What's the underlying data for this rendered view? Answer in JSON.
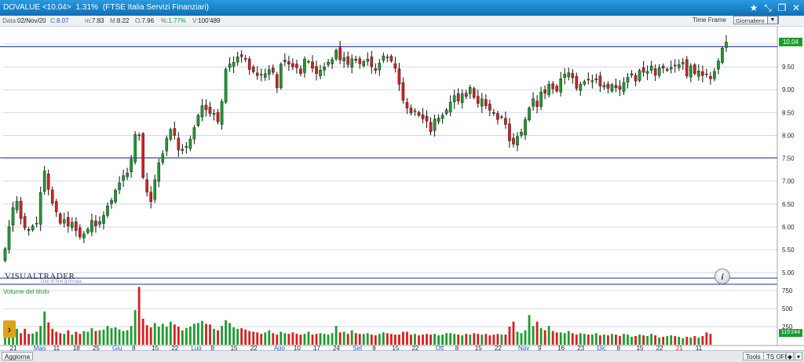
{
  "header": {
    "symbol": "DOVALUE <10.04>",
    "change": "1.31%",
    "market": "(FTSE Italia Servizi Finanziari)"
  },
  "quote": {
    "data_label": "Data:",
    "data_value": "02/Nov/20",
    "close_label": "C:",
    "close_value": "8.07",
    "min_label": "m:",
    "min_value": "7.83",
    "max_label": "M:",
    "max_value": "8.22",
    "open_label": "O:",
    "open_value": "7.96",
    "pct_label": "%:",
    "pct_value": "1.77%",
    "vol_label": "V:",
    "vol_value": "100'489"
  },
  "timeframe": {
    "label": "Time Frame",
    "selected": "Giornaliero"
  },
  "branding": {
    "logo": "VISUALTRADER",
    "subtitle": "Dati di fine giornata"
  },
  "volume_label": "Volume del titolo",
  "price_tag": "10.04",
  "volume_tag": "115'244",
  "bottom": {
    "refresh": "Aggiorna",
    "tools": "Tools",
    "ts": "TS OFF"
  },
  "colors": {
    "up": "#1e9b2e",
    "down": "#d42020",
    "hline": "#1f2f9a",
    "grid": "#d4d8e6",
    "title_bg": "#1a82cc"
  },
  "icons": [
    "star-icon",
    "resize-icon",
    "restore-icon",
    "close-icon",
    "info-icon",
    "chevron-right-icon"
  ],
  "chart_data": {
    "type": "candlestick",
    "y_ticks": [
      "10.00",
      "9.50",
      "9.00",
      "8.50",
      "8.00",
      "7.50",
      "7.00",
      "6.50",
      "6.00",
      "5.50",
      "5.00"
    ],
    "ylim": [
      4.85,
      10.25
    ],
    "volume_ticks": [
      "750",
      "500",
      "250"
    ],
    "volume_lim": [
      0,
      900
    ],
    "horizontal_levels": [
      9.94,
      7.51,
      4.88
    ],
    "x_labels": [
      {
        "text": "21",
        "i": 2,
        "month": false
      },
      {
        "text": "Mag",
        "i": 8,
        "month": true
      },
      {
        "text": "11",
        "i": 13,
        "month": false
      },
      {
        "text": "18",
        "i": 18,
        "month": false
      },
      {
        "text": "25",
        "i": 23,
        "month": false
      },
      {
        "text": "Giu",
        "i": 28,
        "month": true
      },
      {
        "text": "8",
        "i": 33,
        "month": false
      },
      {
        "text": "15",
        "i": 38,
        "month": false
      },
      {
        "text": "22",
        "i": 43,
        "month": false
      },
      {
        "text": "Lug",
        "i": 48,
        "month": true
      },
      {
        "text": "8",
        "i": 53,
        "month": false
      },
      {
        "text": "15",
        "i": 58,
        "month": false
      },
      {
        "text": "22",
        "i": 63,
        "month": false
      },
      {
        "text": "Ago",
        "i": 69,
        "month": true
      },
      {
        "text": "10",
        "i": 74,
        "month": false
      },
      {
        "text": "17",
        "i": 79,
        "month": false
      },
      {
        "text": "24",
        "i": 84,
        "month": false
      },
      {
        "text": "Set",
        "i": 89,
        "month": true
      },
      {
        "text": "8",
        "i": 94,
        "month": false
      },
      {
        "text": "15",
        "i": 99,
        "month": false
      },
      {
        "text": "22",
        "i": 104,
        "month": false
      },
      {
        "text": "Ott",
        "i": 110,
        "month": true
      },
      {
        "text": "8",
        "i": 115,
        "month": false
      },
      {
        "text": "15",
        "i": 120,
        "month": false
      },
      {
        "text": "22",
        "i": 125,
        "month": false
      },
      {
        "text": "Nov",
        "i": 131,
        "month": true
      },
      {
        "text": "9",
        "i": 136,
        "month": false
      },
      {
        "text": "16",
        "i": 141,
        "month": false
      },
      {
        "text": "23",
        "i": 146,
        "month": false
      },
      {
        "text": "Dic",
        "i": 151,
        "month": true
      },
      {
        "text": "8",
        "i": 156,
        "month": false
      },
      {
        "text": "15",
        "i": 161,
        "month": false
      },
      {
        "text": "22",
        "i": 166,
        "month": false
      },
      {
        "text": "21",
        "i": 171,
        "month": true,
        "red": true
      },
      {
        "text": "11",
        "i": 176,
        "month": false
      }
    ],
    "closes": [
      5.52,
      6.0,
      6.42,
      6.56,
      6.18,
      5.98,
      5.92,
      6.02,
      6.08,
      6.75,
      7.22,
      6.82,
      6.52,
      6.33,
      6.08,
      6.16,
      6.02,
      6.1,
      5.92,
      5.78,
      5.85,
      5.95,
      6.14,
      6.02,
      6.12,
      6.25,
      6.46,
      6.58,
      6.8,
      6.96,
      7.12,
      7.18,
      7.48,
      8.02,
      8.0,
      7.08,
      6.76,
      6.55,
      7.03,
      7.4,
      7.6,
      7.94,
      8.13,
      8.0,
      7.68,
      7.7,
      7.76,
      7.92,
      8.17,
      8.44,
      8.65,
      8.56,
      8.48,
      8.48,
      8.3,
      8.74,
      9.45,
      9.56,
      9.6,
      9.72,
      9.72,
      9.66,
      9.44,
      9.39,
      9.31,
      9.33,
      9.35,
      9.44,
      9.38,
      9.04,
      9.56,
      9.65,
      9.56,
      9.5,
      9.48,
      9.35,
      9.67,
      9.62,
      9.47,
      9.35,
      9.43,
      9.5,
      9.6,
      9.66,
      9.86,
      9.65,
      9.7,
      9.55,
      9.68,
      9.64,
      9.57,
      9.62,
      9.67,
      9.5,
      9.42,
      9.58,
      9.74,
      9.71,
      9.63,
      9.47,
      9.12,
      8.77,
      8.6,
      8.49,
      8.54,
      8.44,
      8.36,
      8.31,
      8.08,
      8.36,
      8.38,
      8.44,
      8.56,
      8.73,
      8.87,
      8.75,
      8.91,
      8.85,
      9.05,
      8.83,
      8.7,
      8.8,
      8.65,
      8.55,
      8.48,
      8.35,
      8.41,
      8.24,
      7.88,
      7.81,
      7.98,
      8.07,
      8.35,
      8.6,
      8.8,
      8.63,
      8.95,
      8.92,
      9.12,
      9.02,
      8.97,
      9.24,
      9.34,
      9.37,
      9.26,
      9.03,
      9.12,
      9.18,
      9.21,
      9.2,
      9.24,
      9.08,
      9.1,
      9.03,
      9.11,
      9.04,
      9.01,
      9.16,
      9.27,
      9.35,
      9.19,
      9.42,
      9.38,
      9.4,
      9.52,
      9.32,
      9.48,
      9.47,
      9.45,
      9.49,
      9.52,
      9.55,
      9.6,
      9.3,
      9.52,
      9.35,
      9.41,
      9.31,
      9.34,
      9.24,
      9.4,
      9.63,
      9.91,
      10.04
    ],
    "volumes": [
      213,
      261,
      187,
      220,
      160,
      220,
      150,
      155,
      180,
      260,
      460,
      310,
      220,
      180,
      160,
      150,
      200,
      140,
      180,
      150,
      190,
      180,
      230,
      190,
      200,
      210,
      260,
      230,
      240,
      210,
      190,
      200,
      260,
      480,
      800,
      360,
      270,
      240,
      300,
      250,
      290,
      250,
      320,
      280,
      250,
      200,
      230,
      250,
      290,
      300,
      330,
      290,
      280,
      220,
      200,
      260,
      340,
      300,
      240,
      220,
      230,
      210,
      190,
      180,
      170,
      150,
      170,
      200,
      160,
      140,
      180,
      160,
      150,
      170,
      150,
      140,
      150,
      180,
      140,
      150,
      160,
      150,
      140,
      160,
      260,
      170,
      180,
      150,
      200,
      160,
      150,
      150,
      160,
      140,
      130,
      150,
      170,
      160,
      150,
      140,
      140,
      180,
      180,
      140,
      150,
      130,
      140,
      150,
      140,
      150,
      130,
      140,
      160,
      160,
      150,
      140,
      130,
      150,
      140,
      160,
      150,
      140,
      150,
      130,
      140,
      150,
      140,
      140,
      250,
      320,
      180,
      160,
      200,
      410,
      260,
      320,
      230,
      200,
      260,
      190,
      170,
      170,
      160,
      190,
      160,
      140,
      160,
      150,
      140,
      140,
      160,
      130,
      140,
      130,
      150,
      140,
      120,
      150,
      140,
      110,
      120,
      140,
      130,
      120,
      150,
      130,
      100,
      110,
      120,
      130,
      120,
      110,
      90,
      110,
      100,
      120,
      100,
      120,
      170,
      150
    ]
  }
}
